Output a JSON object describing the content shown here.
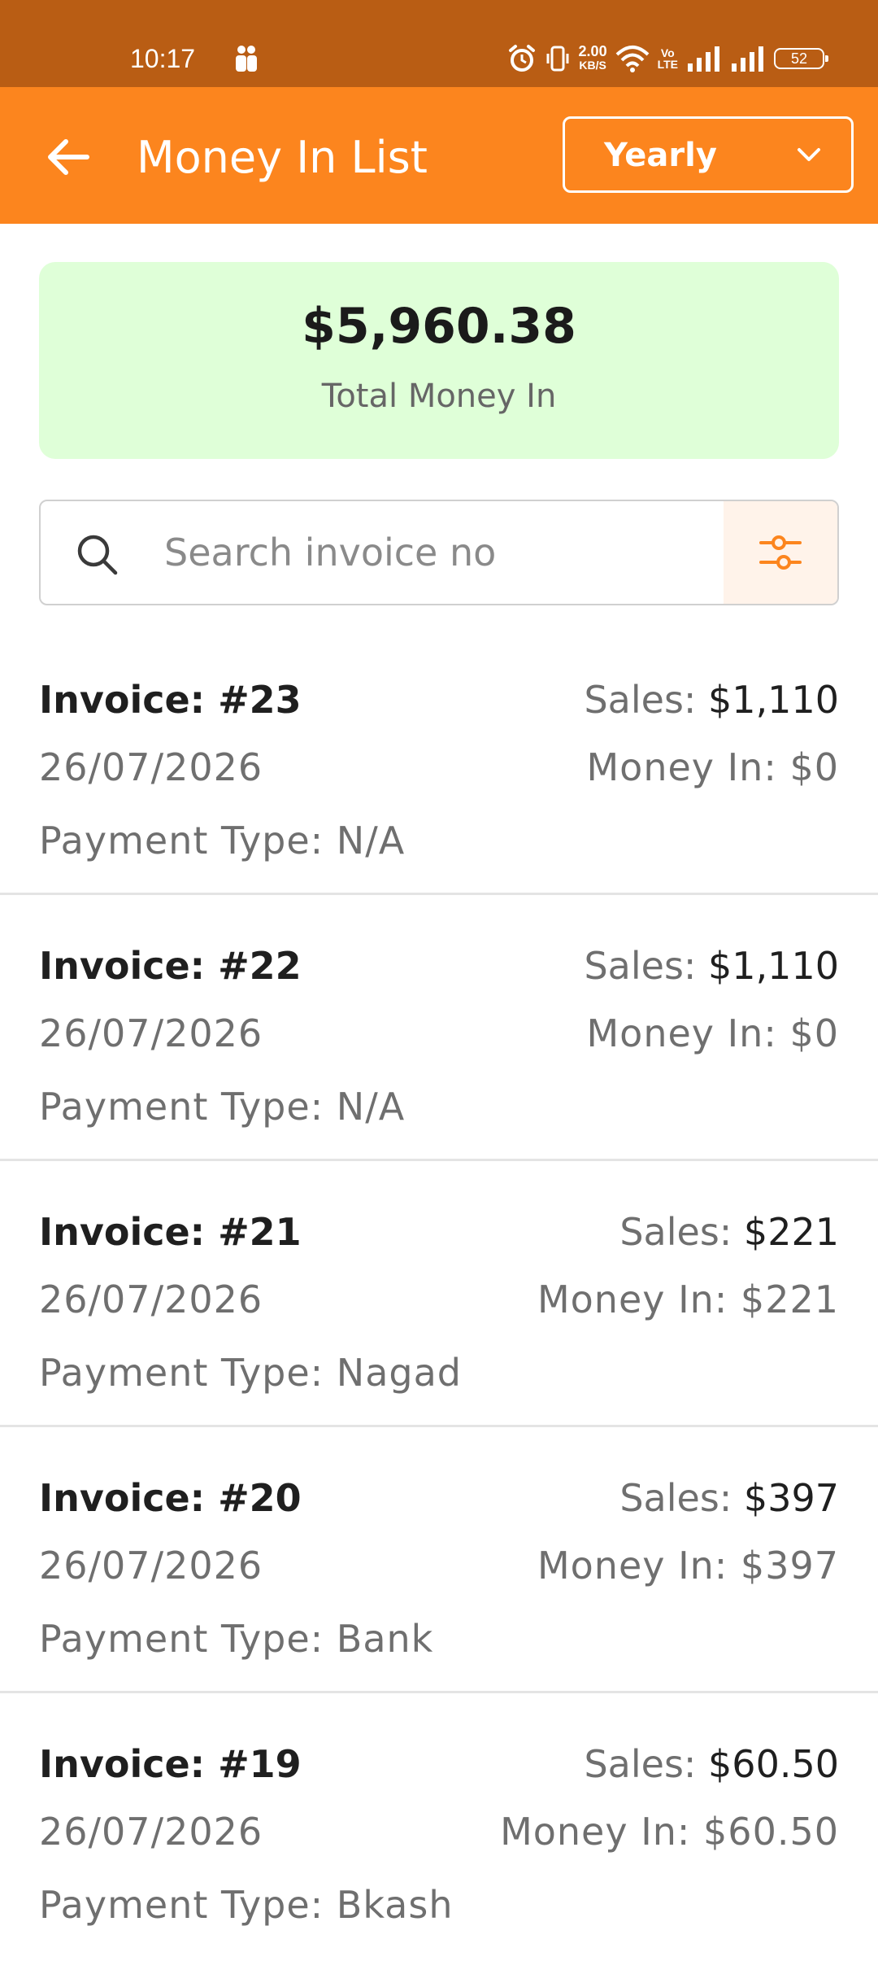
{
  "status_bar": {
    "time": "10:17",
    "net_speed_value": "2.00",
    "net_speed_unit": "KB/S",
    "volte_top": "Vo",
    "volte_bottom": "LTE",
    "battery": "52"
  },
  "header": {
    "title": "Money In List",
    "period": "Yearly"
  },
  "summary": {
    "amount": "$5,960.38",
    "label": "Total Money In"
  },
  "search": {
    "placeholder": "Search invoice no",
    "value": ""
  },
  "invoices": [
    {
      "number": "Invoice: #23",
      "date": "26/07/2026",
      "payment_type": "Payment Type: N/A",
      "sales_label": "Sales:",
      "sales_value": "$1,110",
      "money_in": "Money In: $0"
    },
    {
      "number": "Invoice: #22",
      "date": "26/07/2026",
      "payment_type": "Payment Type: N/A",
      "sales_label": "Sales:",
      "sales_value": "$1,110",
      "money_in": "Money In: $0"
    },
    {
      "number": "Invoice: #21",
      "date": "26/07/2026",
      "payment_type": "Payment Type: Nagad",
      "sales_label": "Sales:",
      "sales_value": "$221",
      "money_in": "Money In: $221"
    },
    {
      "number": "Invoice: #20",
      "date": "26/07/2026",
      "payment_type": "Payment Type: Bank",
      "sales_label": "Sales:",
      "sales_value": "$397",
      "money_in": "Money In: $397"
    },
    {
      "number": "Invoice: #19",
      "date": "26/07/2026",
      "payment_type": "Payment Type: Bkash",
      "sales_label": "Sales:",
      "sales_value": "$60.50",
      "money_in": "Money In: $60.50"
    }
  ],
  "icons": {
    "back": "arrow-left-icon",
    "dropdown": "chevron-down-icon",
    "search": "search-icon",
    "filter": "sliders-icon"
  },
  "colors": {
    "status_bar": "#b95d14",
    "app_bar": "#fc851e",
    "summary_bg": "#dfffd8",
    "accent": "#fc851e"
  }
}
